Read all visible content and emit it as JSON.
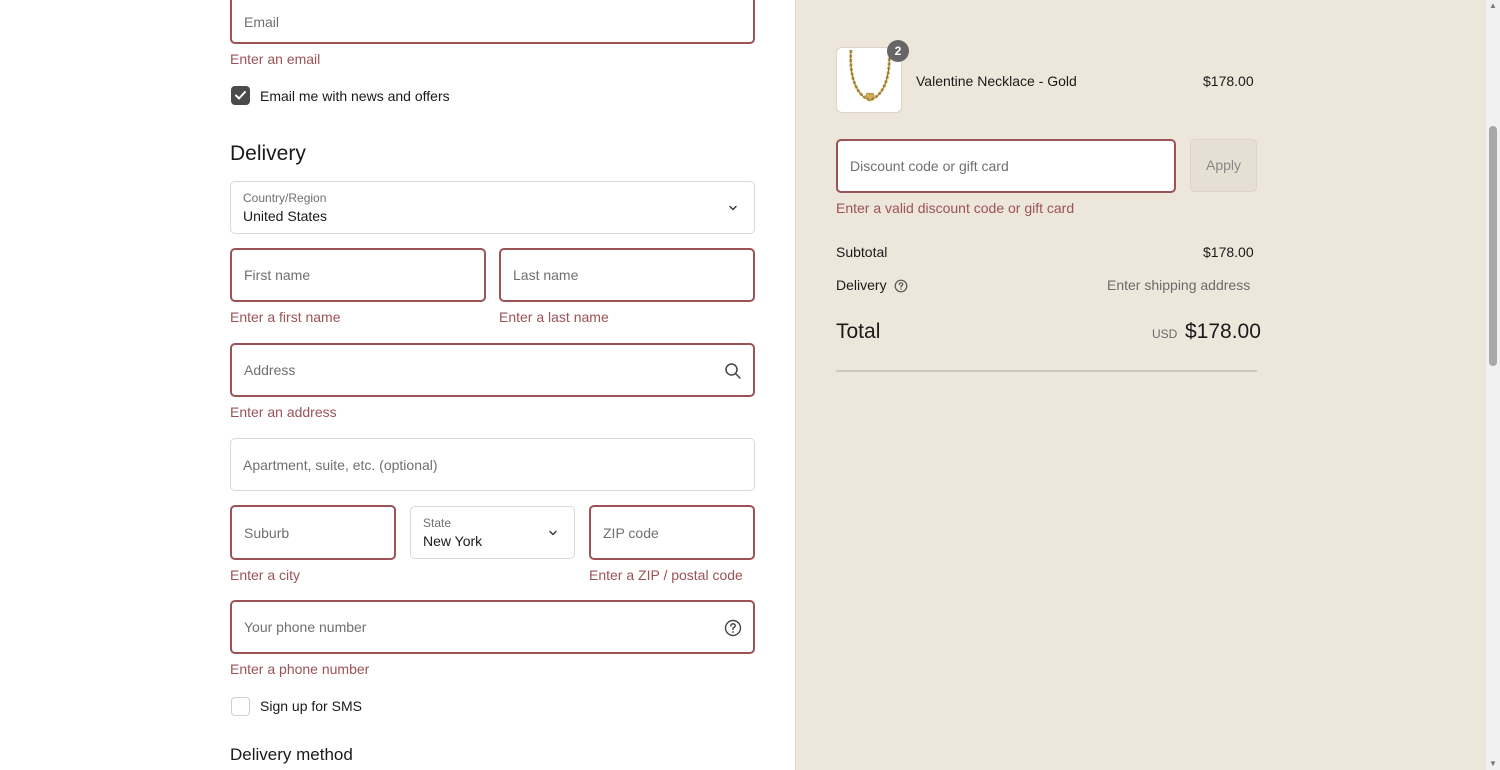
{
  "contact": {
    "email_placeholder": "Email",
    "email_error": "Enter an email",
    "news_label": "Email me with news and offers",
    "news_checked": true
  },
  "delivery": {
    "heading": "Delivery",
    "country_label": "Country/Region",
    "country_value": "United States",
    "first_name_placeholder": "First name",
    "first_name_error": "Enter a first name",
    "last_name_placeholder": "Last name",
    "last_name_error": "Enter a last name",
    "address_placeholder": "Address",
    "address_error": "Enter an address",
    "apartment_placeholder": "Apartment, suite, etc. (optional)",
    "city_placeholder": "Suburb",
    "city_error": "Enter a city",
    "state_label": "State",
    "state_value": "New York",
    "zip_placeholder": "ZIP code",
    "zip_error": "Enter a ZIP / postal code",
    "phone_placeholder": "Your phone number",
    "phone_error": "Enter a phone number",
    "sms_label": "Sign up for SMS",
    "sms_checked": false,
    "method_heading": "Delivery method"
  },
  "summary": {
    "item": {
      "name": "Valentine Necklace - Gold",
      "price": "$178.00",
      "quantity": "2"
    },
    "discount_placeholder": "Discount code or gift card",
    "apply_label": "Apply",
    "discount_error": "Enter a valid discount code or gift card",
    "subtotal_label": "Subtotal",
    "subtotal_value": "$178.00",
    "delivery_label": "Delivery",
    "delivery_value": "Enter shipping address",
    "total_label": "Total",
    "currency": "USD",
    "total_value": "$178.00"
  },
  "colors": {
    "error": "#9b5357",
    "summary_bg": "#ede6db"
  }
}
